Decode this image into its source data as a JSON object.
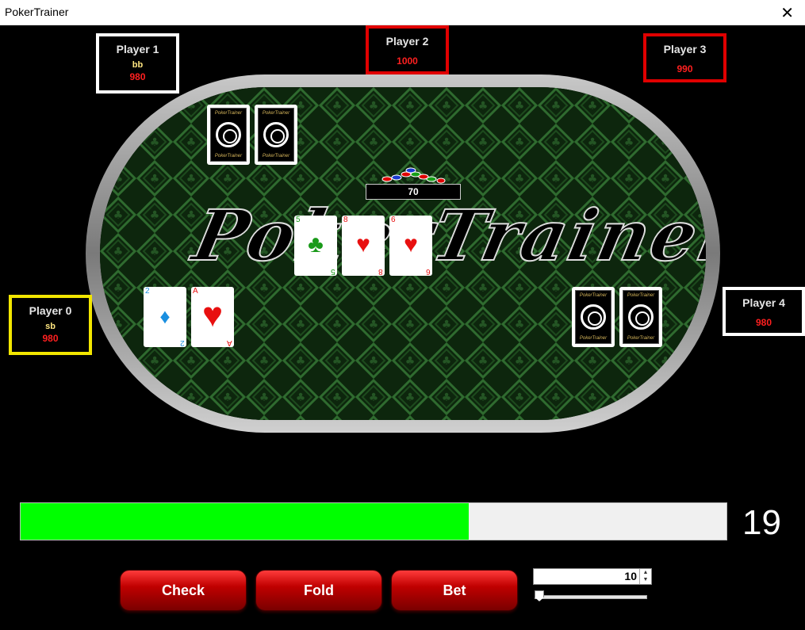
{
  "window": {
    "title": "PokerTrainer",
    "close_glyph": "✕"
  },
  "table": {
    "logo_text": "PokerTrainer",
    "pot": "70"
  },
  "players": [
    {
      "name": "Player 0",
      "role": "sb",
      "chips": "980",
      "border": "#f2e600"
    },
    {
      "name": "Player 1",
      "role": "bb",
      "chips": "980",
      "border": "#ffffff"
    },
    {
      "name": "Player 2",
      "role": "",
      "chips": "1000",
      "border": "#e00000"
    },
    {
      "name": "Player 3",
      "role": "",
      "chips": "990",
      "border": "#e00000"
    },
    {
      "name": "Player 4",
      "role": "",
      "chips": "980",
      "border": "#ffffff"
    }
  ],
  "hero_cards": [
    {
      "rank": "2",
      "suit": "♦",
      "color": "#1a8fe0"
    },
    {
      "rank": "A",
      "suit": "♥",
      "color": "#e81010"
    }
  ],
  "board_cards": [
    {
      "rank": "5",
      "suit": "♣",
      "color": "#1a9a1a"
    },
    {
      "rank": "8",
      "suit": "♥",
      "color": "#e81010"
    },
    {
      "rank": "6",
      "suit": "♥",
      "color": "#e81010"
    }
  ],
  "card_back_text": "PokerTrainer",
  "timer": {
    "fraction": 0.635,
    "seconds": "19",
    "fill_color": "#00ff00"
  },
  "actions": {
    "check": "Check",
    "fold": "Fold",
    "bet": "Bet"
  },
  "bet_amount": {
    "value": "10",
    "slider_fraction": 0.0
  }
}
